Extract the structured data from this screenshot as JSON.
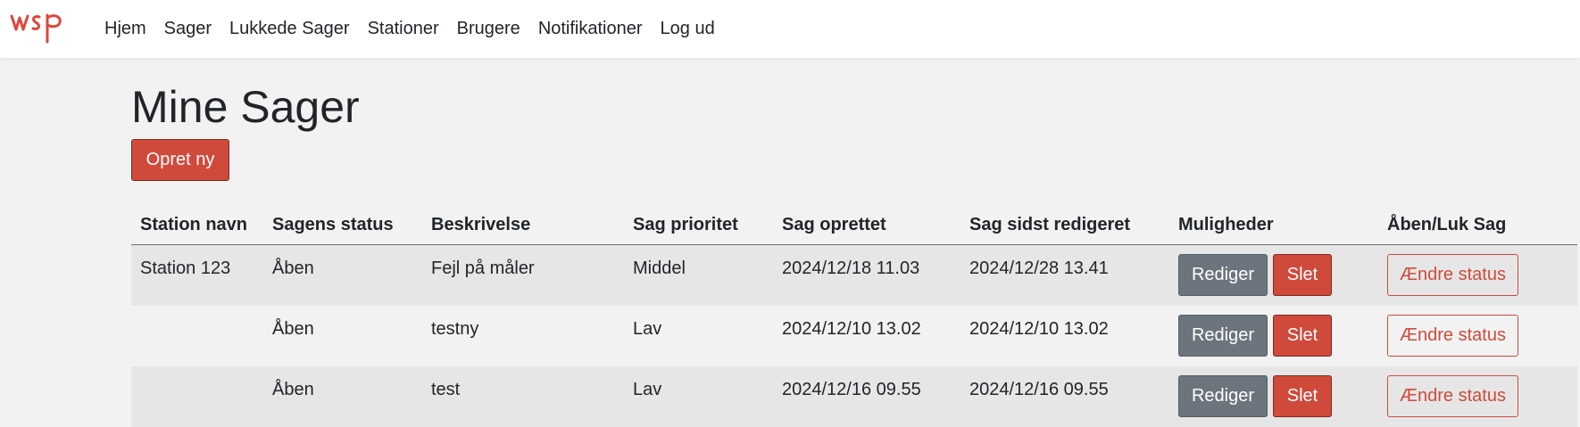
{
  "nav": {
    "logo_text": "wsp",
    "links": [
      "Hjem",
      "Sager",
      "Lukkede Sager",
      "Stationer",
      "Brugere",
      "Notifikationer",
      "Log ud"
    ]
  },
  "page": {
    "title": "Mine Sager",
    "create_label": "Opret ny"
  },
  "table": {
    "headers": [
      "Station navn",
      "Sagens status",
      "Beskrivelse",
      "Sag prioritet",
      "Sag oprettet",
      "Sag sidst redigeret",
      "Muligheder",
      "Åben/Luk Sag"
    ],
    "rows": [
      {
        "station": "Station 123",
        "status": "Åben",
        "description": "Fejl på måler",
        "priority": "Middel",
        "created": "2024/12/18 11.03",
        "edited": "2024/12/28 13.41"
      },
      {
        "station": "",
        "status": "Åben",
        "description": "testny",
        "priority": "Lav",
        "created": "2024/12/10 13.02",
        "edited": "2024/12/10 13.02"
      },
      {
        "station": "",
        "status": "Åben",
        "description": "test",
        "priority": "Lav",
        "created": "2024/12/16 09.55",
        "edited": "2024/12/16 09.55"
      }
    ],
    "edit_label": "Rediger",
    "delete_label": "Slet",
    "change_status_label": "Ændre status"
  },
  "colors": {
    "brand": "#d04a3b",
    "secondary": "#6c757d",
    "background": "#f2f2f2",
    "row_stripe": "#e6e6e6"
  }
}
